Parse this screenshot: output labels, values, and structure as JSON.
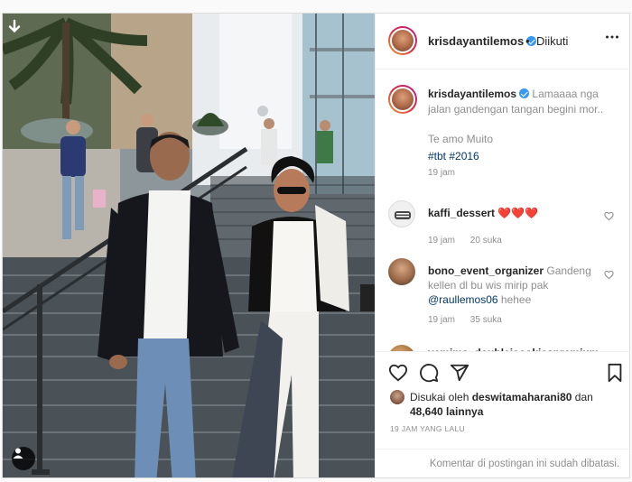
{
  "author": {
    "username": "krisdayantilemos",
    "verified": true,
    "follow_separator": "•",
    "follow_status": "Diikuti"
  },
  "caption": {
    "text": "Lamaaaa nga jalan gandengan tangan begini mor..",
    "line2": "Te amo Muito",
    "hashtags": [
      "#tbt",
      "#2016"
    ],
    "time": "19 jam"
  },
  "comments": [
    {
      "username": "kaffi_dessert",
      "text": "❤️❤️❤️",
      "time": "19 jam",
      "likes": "20 suka"
    },
    {
      "username": "bono_event_organizer",
      "text": "Gandeng kellen dl bu wis mirip pak",
      "mention": "@raullemos06",
      "text_after": "hehee",
      "time": "19 jam",
      "likes": "35 suka"
    },
    {
      "username": "yemima_doublejcookiespremium",
      "text": "❤️❤️"
    }
  ],
  "likes": {
    "prefix": "Disukai oleh",
    "user": "deswitamaharani80",
    "connector": "dan",
    "count": "48,640 lainnya"
  },
  "post_time": "19 JAM YANG LALU",
  "comments_limited": "Komentar di postingan ini sudah dibatasi.",
  "colors": {
    "verified": "#3897f0",
    "link": "#00376b",
    "secondary_text": "#8e8e8e",
    "border": "#dbdbdb"
  },
  "icons": [
    "download-icon",
    "user-tag-icon",
    "more-options-icon",
    "like-icon",
    "comment-icon",
    "share-icon",
    "save-icon",
    "comment-like-icon"
  ]
}
